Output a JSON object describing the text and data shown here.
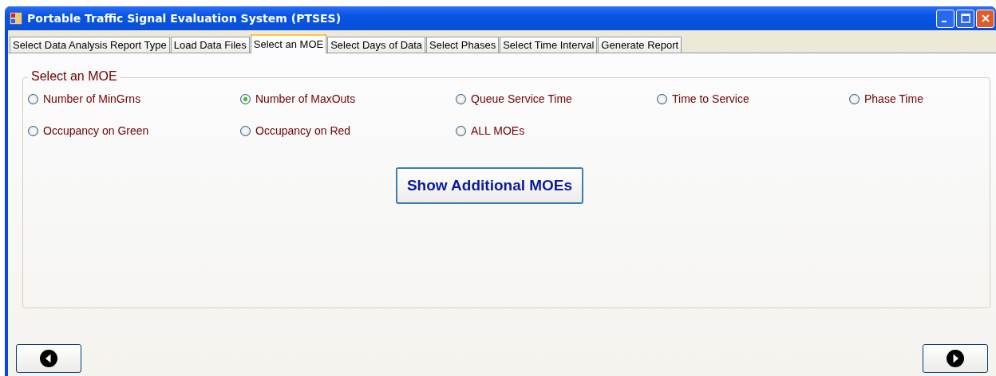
{
  "window": {
    "title": "Portable Traffic Signal Evaluation System (PTSES)"
  },
  "tabs": [
    {
      "label": "Select Data Analysis Report Type",
      "selected": false
    },
    {
      "label": "Load Data Files",
      "selected": false
    },
    {
      "label": "Select an MOE",
      "selected": true
    },
    {
      "label": "Select Days of Data",
      "selected": false
    },
    {
      "label": "Select Phases",
      "selected": false
    },
    {
      "label": "Select Time Interval",
      "selected": false
    },
    {
      "label": "Generate Report",
      "selected": false
    }
  ],
  "group": {
    "title": "Select an MOE",
    "options": [
      {
        "label": "Number of MinGrns",
        "selected": false
      },
      {
        "label": "Number of MaxOuts",
        "selected": true
      },
      {
        "label": "Queue Service Time",
        "selected": false
      },
      {
        "label": "Time to Service",
        "selected": false
      },
      {
        "label": "Phase Time",
        "selected": false
      },
      {
        "label": "Occupancy on Green",
        "selected": false
      },
      {
        "label": "Occupancy on Red",
        "selected": false
      },
      {
        "label": "ALL MOEs",
        "selected": false
      }
    ],
    "button": "Show Additional MOEs"
  }
}
